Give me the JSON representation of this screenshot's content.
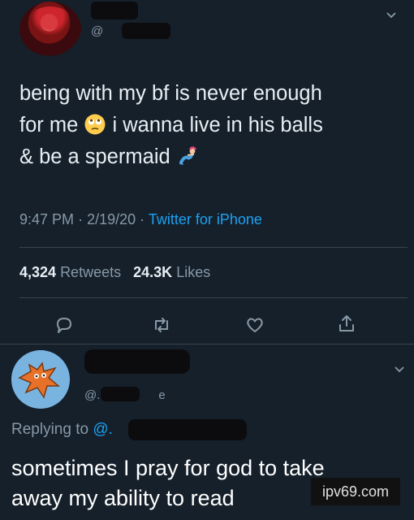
{
  "tweet": {
    "handle_prefix": "@",
    "text_line1": "being with my bf is never enough",
    "text_line2a": "for me",
    "text_line2b": "i wanna live in his balls",
    "text_line3": "& be a spermaid",
    "emoji1": "rolling-eyes-emoji",
    "emoji2": "mermaid-emoji",
    "time": "9:47 PM",
    "date": "2/19/20",
    "source": "Twitter for iPhone",
    "retweets_count": "4,324",
    "retweets_label": "Retweets",
    "likes_count": "24.3K",
    "likes_label": "Likes"
  },
  "reply": {
    "handle_prefix": "@.",
    "handle_suffix": "e",
    "replying_label": "Replying to",
    "replying_at": "@.",
    "text_line1": "sometimes I pray for god to take",
    "text_line2": "away my ability to read"
  },
  "watermark": "ipv69.com",
  "colors": {
    "background": "#15202b",
    "accent": "#1da1f2",
    "muted": "#8899a6",
    "divider": "#38444d"
  }
}
